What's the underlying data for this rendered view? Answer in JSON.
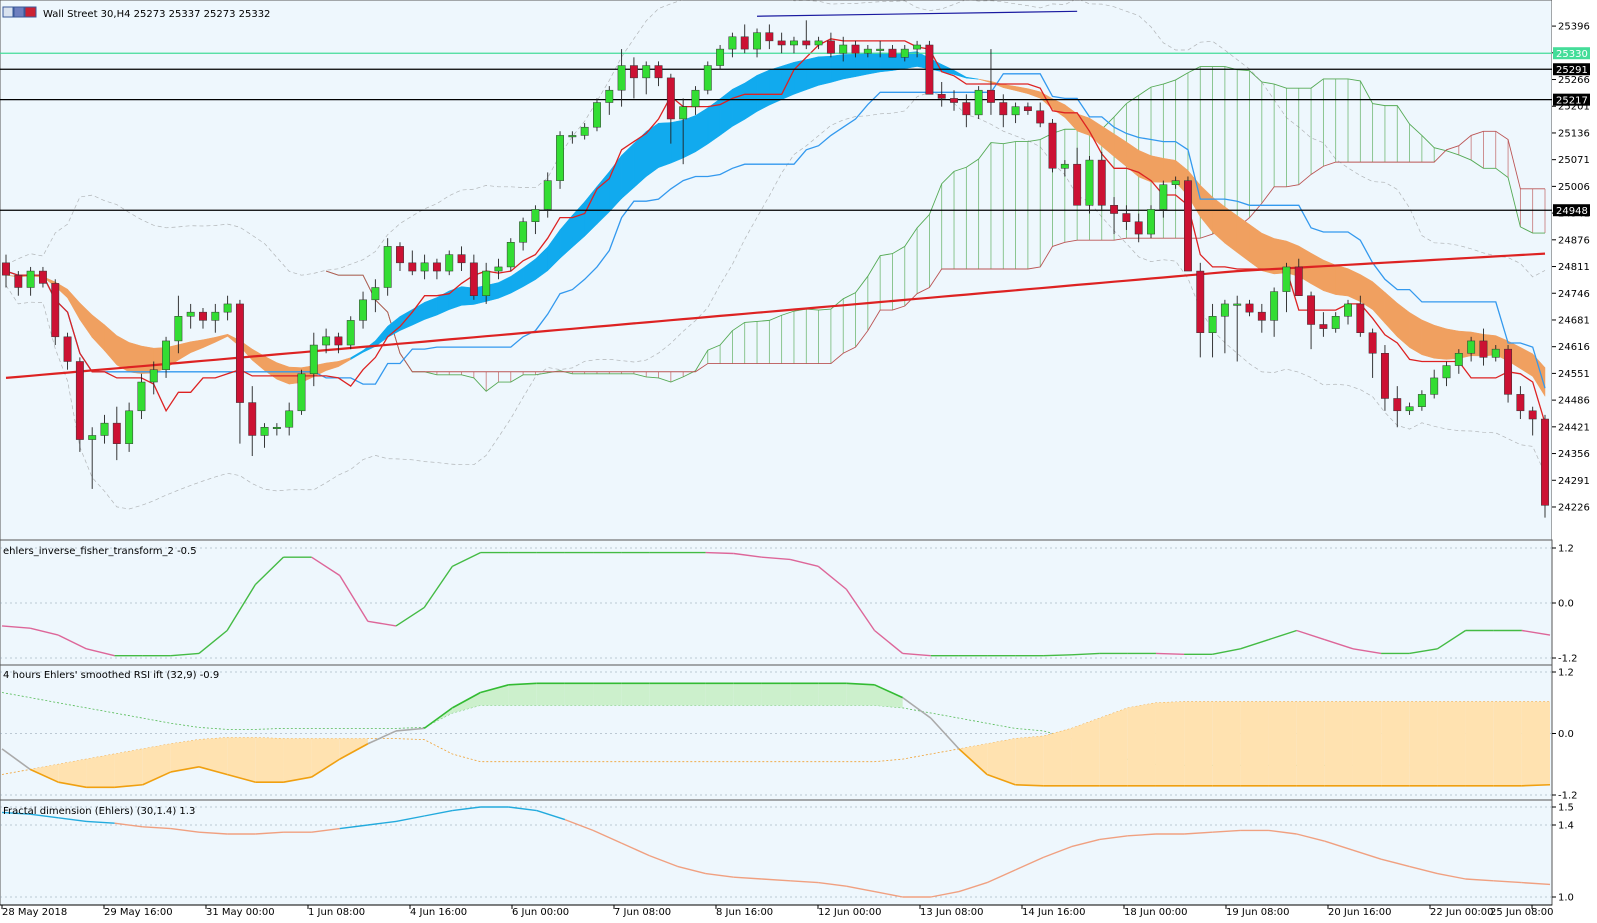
{
  "window": {
    "title": "Wall Street 30,H4  25273 25337 25273 25332",
    "icons": [
      "window-restore-icon",
      "window-minimize-icon",
      "window-close-icon"
    ]
  },
  "colors": {
    "background": "#eef7fd",
    "bull": "#33dd33",
    "bear": "#cc1133",
    "kijun": "#3399ee",
    "tenkan": "#dd2222",
    "ma200": "#dd2222",
    "cloud_bull": "#55aa55",
    "cloud_bear": "#bb5555",
    "band_cyan": "#11aaee",
    "band_orange": "#f0a060",
    "level_line": "#000000",
    "level_cyan": "#44dd99",
    "upper_line": "#1a1aa0",
    "bb": "#888888"
  },
  "price_axis": {
    "ticks": [
      "25396",
      "25331",
      "25266",
      "25201",
      "25136",
      "25071",
      "25006",
      "24941",
      "24876",
      "24811",
      "24746",
      "24681",
      "24616",
      "24551",
      "24486",
      "24421",
      "24356",
      "24291",
      "24226"
    ],
    "tags": [
      {
        "label": "25330",
        "color": "#44dd99",
        "text_color": "#ffffff"
      },
      {
        "label": "25291",
        "color": "#000000",
        "text_color": "#ffffff"
      },
      {
        "label": "25217",
        "color": "#000000",
        "text_color": "#ffffff"
      },
      {
        "label": "24948",
        "color": "#000000",
        "text_color": "#ffffff"
      }
    ]
  },
  "time_axis": {
    "labels": [
      "28 May 2018",
      "29 May 16:00",
      "31 May 00:00",
      "1 Jun 08:00",
      "4 Jun 16:00",
      "6 Jun 00:00",
      "7 Jun 08:00",
      "8 Jun 16:00",
      "12 Jun 00:00",
      "13 Jun 08:00",
      "14 Jun 16:00",
      "18 Jun 00:00",
      "19 Jun 08:00",
      "20 Jun 16:00",
      "22 Jun 00:00",
      "25 Jun 08:00"
    ]
  },
  "chart_data": [
    {
      "type": "candlestick",
      "title": "Wall Street 30,H4  25273 25337 25273 25332",
      "ylim": [
        24170,
        25440
      ],
      "levels": [
        25330,
        25291,
        25217,
        24948
      ],
      "candles": [
        [
          24820,
          24840,
          24760,
          24790
        ],
        [
          24790,
          24800,
          24740,
          24760
        ],
        [
          24760,
          24810,
          24740,
          24800
        ],
        [
          24800,
          24810,
          24760,
          24770
        ],
        [
          24770,
          24780,
          24620,
          24640
        ],
        [
          24640,
          24650,
          24560,
          24580
        ],
        [
          24580,
          24590,
          24360,
          24390
        ],
        [
          24390,
          24420,
          24270,
          24400
        ],
        [
          24400,
          24450,
          24380,
          24430
        ],
        [
          24430,
          24470,
          24340,
          24380
        ],
        [
          24380,
          24480,
          24360,
          24460
        ],
        [
          24460,
          24550,
          24440,
          24530
        ],
        [
          24530,
          24580,
          24500,
          24560
        ],
        [
          24560,
          24640,
          24540,
          24630
        ],
        [
          24630,
          24740,
          24600,
          24690
        ],
        [
          24690,
          24720,
          24660,
          24700
        ],
        [
          24700,
          24710,
          24660,
          24680
        ],
        [
          24680,
          24720,
          24650,
          24700
        ],
        [
          24700,
          24740,
          24680,
          24720
        ],
        [
          24720,
          24730,
          24380,
          24480
        ],
        [
          24480,
          24520,
          24350,
          24400
        ],
        [
          24400,
          24430,
          24370,
          24420
        ],
        [
          24420,
          24430,
          24400,
          24420
        ],
        [
          24420,
          24480,
          24400,
          24460
        ],
        [
          24460,
          24560,
          24450,
          24550
        ],
        [
          24550,
          24650,
          24520,
          24620
        ],
        [
          24620,
          24660,
          24600,
          24640
        ],
        [
          24640,
          24650,
          24600,
          24620
        ],
        [
          24620,
          24690,
          24610,
          24680
        ],
        [
          24680,
          24750,
          24660,
          24730
        ],
        [
          24730,
          24780,
          24700,
          24760
        ],
        [
          24760,
          24880,
          24740,
          24860
        ],
        [
          24860,
          24870,
          24800,
          24820
        ],
        [
          24820,
          24850,
          24790,
          24800
        ],
        [
          24800,
          24840,
          24780,
          24820
        ],
        [
          24820,
          24830,
          24780,
          24800
        ],
        [
          24800,
          24850,
          24790,
          24840
        ],
        [
          24840,
          24860,
          24800,
          24820
        ],
        [
          24820,
          24840,
          24730,
          24740
        ],
        [
          24740,
          24820,
          24720,
          24800
        ],
        [
          24800,
          24830,
          24780,
          24810
        ],
        [
          24810,
          24880,
          24800,
          24870
        ],
        [
          24870,
          24930,
          24850,
          24920
        ],
        [
          24920,
          24960,
          24890,
          24950
        ],
        [
          24950,
          25040,
          24930,
          25020
        ],
        [
          25020,
          25140,
          25000,
          25130
        ],
        [
          25130,
          25140,
          25110,
          25130
        ],
        [
          25130,
          25160,
          25120,
          25150
        ],
        [
          25150,
          25220,
          25140,
          25210
        ],
        [
          25210,
          25250,
          25180,
          25240
        ],
        [
          25240,
          25340,
          25200,
          25300
        ],
        [
          25300,
          25320,
          25220,
          25270
        ],
        [
          25270,
          25310,
          25230,
          25300
        ],
        [
          25300,
          25310,
          25250,
          25270
        ],
        [
          25270,
          25280,
          25110,
          25170
        ],
        [
          25170,
          25220,
          25060,
          25200
        ],
        [
          25200,
          25250,
          25180,
          25240
        ],
        [
          25240,
          25310,
          25230,
          25300
        ],
        [
          25300,
          25350,
          25290,
          25340
        ],
        [
          25340,
          25380,
          25320,
          25370
        ],
        [
          25370,
          25400,
          25330,
          25340
        ],
        [
          25340,
          25390,
          25320,
          25380
        ],
        [
          25380,
          25400,
          25340,
          25360
        ],
        [
          25360,
          25380,
          25330,
          25350
        ],
        [
          25350,
          25370,
          25330,
          25360
        ],
        [
          25360,
          25410,
          25340,
          25350
        ],
        [
          25350,
          25370,
          25340,
          25360
        ],
        [
          25360,
          25380,
          25320,
          25330
        ],
        [
          25330,
          25370,
          25310,
          25350
        ],
        [
          25350,
          25360,
          25320,
          25330
        ],
        [
          25330,
          25350,
          25320,
          25340
        ],
        [
          25340,
          25360,
          25320,
          25340
        ],
        [
          25340,
          25350,
          25320,
          25320
        ],
        [
          25320,
          25350,
          25310,
          25340
        ],
        [
          25340,
          25360,
          25320,
          25350
        ],
        [
          25350,
          25360,
          25300,
          25230
        ],
        [
          25230,
          25260,
          25200,
          25220
        ],
        [
          25220,
          25240,
          25190,
          25210
        ],
        [
          25210,
          25230,
          25150,
          25180
        ],
        [
          25180,
          25250,
          25170,
          25240
        ],
        [
          25240,
          25340,
          25180,
          25210
        ],
        [
          25210,
          25230,
          25150,
          25180
        ],
        [
          25180,
          25210,
          25160,
          25200
        ],
        [
          25200,
          25210,
          25180,
          25190
        ],
        [
          25190,
          25210,
          25150,
          25160
        ],
        [
          25160,
          25170,
          25040,
          25050
        ],
        [
          25050,
          25070,
          25030,
          25060
        ],
        [
          25060,
          25100,
          25040,
          24960
        ],
        [
          24960,
          25080,
          24940,
          25070
        ],
        [
          25070,
          25090,
          24950,
          24960
        ],
        [
          24960,
          24980,
          24890,
          24940
        ],
        [
          24940,
          24960,
          24900,
          24920
        ],
        [
          24920,
          24940,
          24870,
          24890
        ],
        [
          24890,
          24960,
          24880,
          24950
        ],
        [
          24950,
          25020,
          24930,
          25010
        ],
        [
          25010,
          25030,
          25000,
          25020
        ],
        [
          25020,
          25030,
          24830,
          24800
        ],
        [
          24800,
          24820,
          24590,
          24650
        ],
        [
          24650,
          24720,
          24590,
          24690
        ],
        [
          24690,
          24730,
          24600,
          24720
        ],
        [
          24720,
          24740,
          24580,
          24720
        ],
        [
          24720,
          24730,
          24690,
          24700
        ],
        [
          24700,
          24720,
          24650,
          24680
        ],
        [
          24680,
          24760,
          24640,
          24750
        ],
        [
          24750,
          24820,
          24700,
          24810
        ],
        [
          24810,
          24830,
          24740,
          24740
        ],
        [
          24740,
          24750,
          24610,
          24670
        ],
        [
          24670,
          24700,
          24640,
          24660
        ],
        [
          24660,
          24700,
          24650,
          24690
        ],
        [
          24690,
          24730,
          24670,
          24720
        ],
        [
          24720,
          24740,
          24640,
          24650
        ],
        [
          24650,
          24660,
          24540,
          24600
        ],
        [
          24600,
          24620,
          24460,
          24490
        ],
        [
          24490,
          24520,
          24420,
          24460
        ],
        [
          24460,
          24480,
          24450,
          24470
        ],
        [
          24470,
          24510,
          24460,
          24500
        ],
        [
          24500,
          24560,
          24490,
          24540
        ],
        [
          24540,
          24580,
          24520,
          24570
        ],
        [
          24570,
          24610,
          24550,
          24600
        ],
        [
          24600,
          24640,
          24580,
          24630
        ],
        [
          24630,
          24660,
          24570,
          24590
        ],
        [
          24590,
          24620,
          24580,
          24610
        ],
        [
          24610,
          24620,
          24480,
          24500
        ],
        [
          24500,
          24520,
          24440,
          24460
        ],
        [
          24460,
          24470,
          24400,
          24440
        ],
        [
          24440,
          24450,
          24200,
          24230
        ]
      ]
    },
    {
      "type": "line",
      "title": "ehlers_inverse_fisher_transform_2 -0.5",
      "ylim": [
        -1.2,
        1.2
      ],
      "levels": [
        1.2,
        0.0,
        -1.2
      ],
      "series": [
        {
          "values": [
            -0.5,
            -0.55,
            -0.7,
            -1.0,
            -1.15,
            -1.15,
            -1.15,
            -1.1,
            -0.6,
            0.4,
            1.0,
            1.0,
            0.6,
            -0.4,
            -0.5,
            -0.1,
            0.8,
            1.1,
            1.1,
            1.1,
            1.1,
            1.1,
            1.1,
            1.1,
            1.1,
            1.1,
            1.08,
            1.0,
            0.95,
            0.8,
            0.3,
            -0.6,
            -1.1,
            -1.15,
            -1.15,
            -1.15,
            -1.15,
            -1.15,
            -1.13,
            -1.1,
            -1.1,
            -1.1,
            -1.12,
            -1.12,
            -1.0,
            -0.8,
            -0.6,
            -0.8,
            -1.0,
            -1.1,
            -1.1,
            -1.0,
            -0.6,
            -0.6,
            -0.6,
            -0.7
          ]
        }
      ]
    },
    {
      "type": "area",
      "title": "4 hours Ehlers' smoothed RSI ift (32,9) -0.9",
      "ylim": [
        -1.2,
        1.2
      ],
      "levels": [
        1.2,
        0.0,
        -1.2
      ],
      "series": [
        {
          "values": [
            -0.3,
            -0.7,
            -0.95,
            -1.05,
            -1.05,
            -1.0,
            -0.75,
            -0.65,
            -0.8,
            -0.95,
            -0.95,
            -0.85,
            -0.5,
            -0.2,
            0.05,
            0.1,
            0.5,
            0.8,
            0.95,
            0.98,
            0.98,
            0.98,
            0.98,
            0.98,
            0.98,
            0.98,
            0.98,
            0.98,
            0.98,
            0.98,
            0.98,
            0.95,
            0.7,
            0.3,
            -0.3,
            -0.8,
            -1.0,
            -1.02,
            -1.02,
            -1.02,
            -1.02,
            -1.02,
            -1.02,
            -1.02,
            -1.02,
            -1.02,
            -1.02,
            -1.02,
            -1.02,
            -1.02,
            -1.02,
            -1.02,
            -1.02,
            -1.02,
            -1.02,
            -1.0
          ]
        },
        {
          "values": [
            0.8,
            0.7,
            0.6,
            0.5,
            0.4,
            0.3,
            0.2,
            0.12,
            0.08,
            0.08,
            0.1,
            0.1,
            0.1,
            0.1,
            0.1,
            0.12,
            0.4,
            0.55,
            0.55,
            0.55,
            0.55,
            0.55,
            0.55,
            0.55,
            0.55,
            0.55,
            0.55,
            0.55,
            0.55,
            0.55,
            0.55,
            0.55,
            0.5,
            0.4,
            0.3,
            0.2,
            0.1,
            0.05,
            -0.1,
            -0.3,
            -0.5,
            -0.6,
            -0.62,
            -0.62,
            -0.62,
            -0.62,
            -0.62,
            -0.62,
            -0.62,
            -0.62,
            -0.62,
            -0.62,
            -0.62,
            -0.62,
            -0.62,
            -0.62
          ]
        }
      ]
    },
    {
      "type": "line",
      "title": "Fractal dimension (Ehlers) (30,1.4) 1.3",
      "ylim": [
        1.0,
        1.5
      ],
      "levels": [
        1.5,
        1.4,
        1.0
      ],
      "series": [
        {
          "values": [
            1.47,
            1.46,
            1.44,
            1.42,
            1.41,
            1.39,
            1.38,
            1.36,
            1.35,
            1.35,
            1.36,
            1.36,
            1.38,
            1.4,
            1.42,
            1.45,
            1.48,
            1.5,
            1.5,
            1.48,
            1.43,
            1.37,
            1.3,
            1.23,
            1.17,
            1.13,
            1.11,
            1.1,
            1.09,
            1.08,
            1.06,
            1.03,
            1.0,
            1.0,
            1.03,
            1.08,
            1.15,
            1.22,
            1.28,
            1.32,
            1.34,
            1.35,
            1.35,
            1.36,
            1.37,
            1.37,
            1.35,
            1.31,
            1.26,
            1.21,
            1.17,
            1.13,
            1.1,
            1.09,
            1.08,
            1.07
          ]
        }
      ]
    }
  ]
}
